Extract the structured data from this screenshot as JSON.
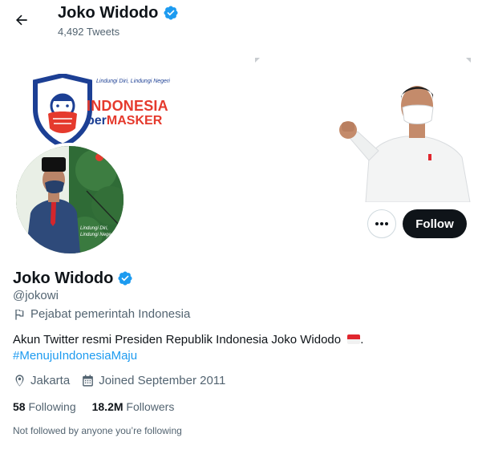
{
  "header": {
    "title": "Joko Widodo",
    "tweet_count": "4,492 Tweets"
  },
  "banner": {
    "campaign_tagline": "Lindungi Diri, Lindungi Negeri",
    "campaign_line1": "INDONESIA",
    "campaign_line2_a": "ber",
    "campaign_line2_b": "MASKER"
  },
  "avatar": {
    "overlay_text_1": "Lindungi Diri,",
    "overlay_text_2": "Lindungi Negeri"
  },
  "actions": {
    "follow_label": "Follow",
    "more_label": "•••"
  },
  "profile": {
    "name": "Joko Widodo",
    "handle": "@jokowi",
    "category": "Pejabat pemerintah Indonesia",
    "bio": "Akun Twitter resmi Presiden Republik Indonesia Joko Widodo",
    "bio_suffix": ".",
    "hashtag": "#MenujuIndonesiaMaju",
    "location": "Jakarta",
    "joined": "Joined September 2011",
    "following_count": "58",
    "following_label": "Following",
    "followers_count": "18.2M",
    "followers_label": "Followers",
    "not_followed_text": "Not followed by anyone you’re following"
  },
  "colors": {
    "verified": "#1d9bf0",
    "follow_bg": "#0f1419",
    "muted": "#536471",
    "link": "#1d9bf0"
  },
  "icons": [
    "back-arrow-icon",
    "verified-badge-icon",
    "more-icon",
    "flag-icon",
    "location-icon",
    "calendar-icon"
  ]
}
